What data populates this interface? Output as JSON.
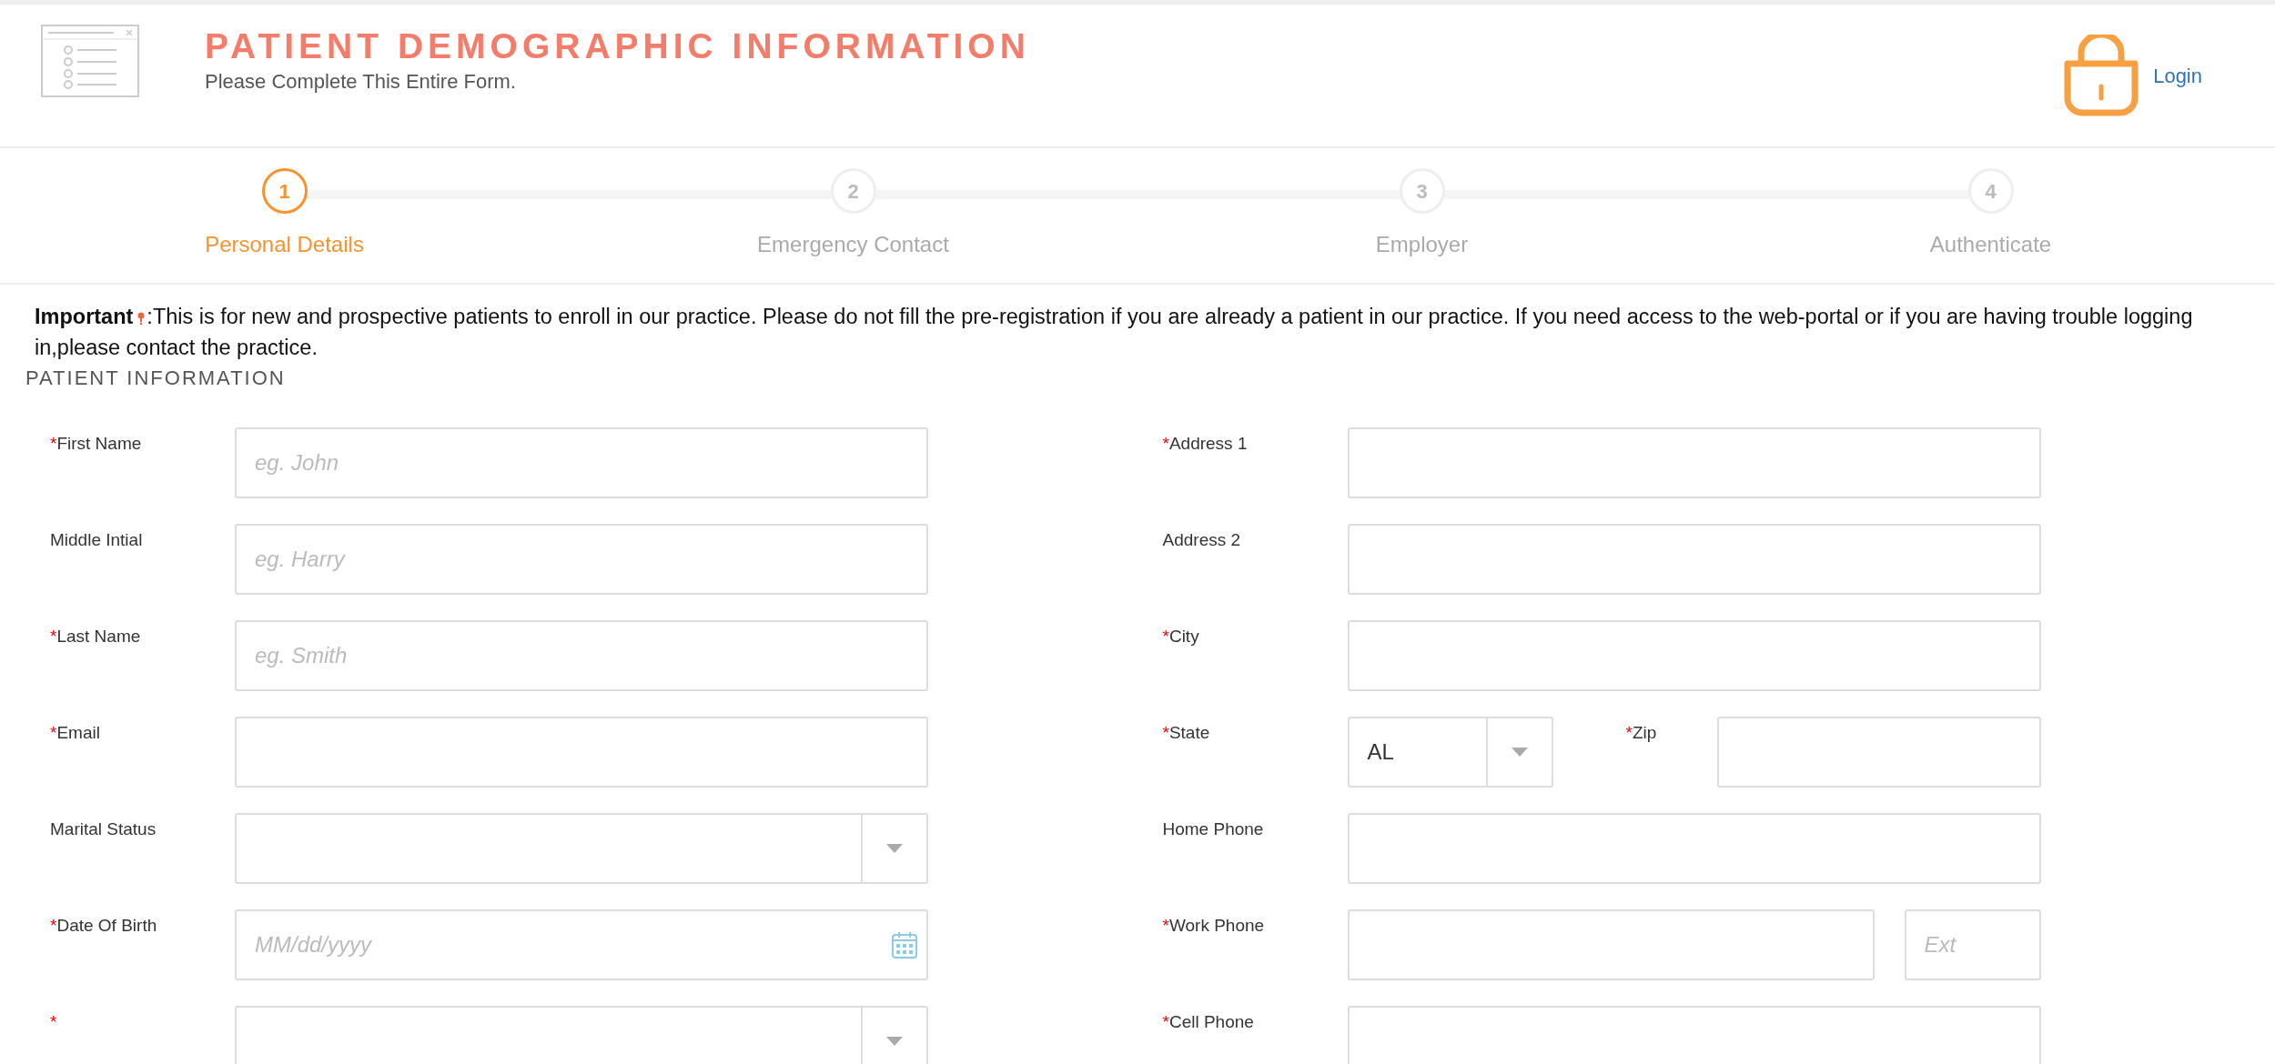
{
  "header": {
    "title": "PATIENT DEMOGRAPHIC INFORMATION",
    "subtitle": "Please Complete This Entire Form.",
    "login": "Login"
  },
  "steps": [
    {
      "number": "1",
      "label": "Personal Details",
      "selected": true
    },
    {
      "number": "2",
      "label": "Emergency Contact",
      "selected": false
    },
    {
      "number": "3",
      "label": "Employer",
      "selected": false
    },
    {
      "number": "4",
      "label": "Authenticate",
      "selected": false
    }
  ],
  "notice": "**Important**:This is for new and prospective patients to enroll in our practice. Please do not fill the pre-registration if you are already a patient in our practice. If you need access to the web-portal or if you are having trouble logging in,please contact the practice.",
  "section_title": "PATIENT INFORMATION",
  "form": {
    "left": [
      {
        "required_mark": "*",
        "label": "First Name",
        "controls": [
          {
            "kind": "text",
            "placeholder": "eg. John"
          }
        ]
      },
      {
        "label": "Middle Intial",
        "controls": [
          {
            "kind": "text",
            "placeholder": "eg. Harry"
          }
        ]
      },
      {
        "required_mark": "*",
        "label": "Last Name",
        "controls": [
          {
            "kind": "text",
            "placeholder": "eg. Smith"
          }
        ]
      },
      {
        "required_mark": "*",
        "label": "Email",
        "controls": [
          {
            "kind": "text"
          }
        ]
      },
      {
        "label": "Marital Status",
        "controls": [
          {
            "kind": "select"
          }
        ]
      },
      {
        "required_mark": "*",
        "label": "Date Of Birth",
        "controls": [
          {
            "kind": "date",
            "placeholder": "MM/dd/yyyy"
          }
        ]
      },
      {
        "required_mark": "*",
        "controls": [
          {
            "kind": "select"
          }
        ]
      }
    ],
    "right": [
      {
        "required_mark": "*",
        "label": "Address 1",
        "controls": [
          {
            "kind": "text"
          }
        ]
      },
      {
        "label": "Address 2",
        "controls": [
          {
            "kind": "text"
          }
        ]
      },
      {
        "required_mark": "*",
        "label": "City",
        "controls": [
          {
            "kind": "text"
          }
        ]
      },
      {
        "required_mark": "*",
        "label": "State",
        "controls": [
          {
            "kind": "select",
            "value": "AL"
          },
          {
            "kind": "label",
            "required_mark": "*",
            "text": "Zip"
          },
          {
            "kind": "text"
          }
        ]
      },
      {
        "label": "Home Phone",
        "controls": [
          {
            "kind": "text"
          }
        ]
      },
      {
        "required_mark": "*",
        "label": "Work Phone",
        "controls": [
          {
            "kind": "text"
          },
          {
            "kind": "text",
            "placeholder": "Ext"
          }
        ]
      },
      {
        "required_mark": "*",
        "label": "Cell Phone",
        "controls": [
          {
            "kind": "text"
          }
        ]
      }
    ]
  }
}
